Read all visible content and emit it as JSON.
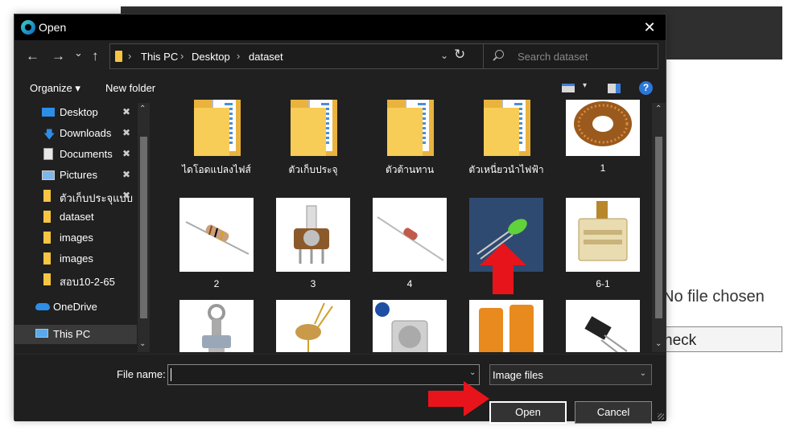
{
  "background": {
    "no_file_text": "No file chosen",
    "check_text": "neck"
  },
  "dialog": {
    "title": "Open",
    "close_glyph": "✕"
  },
  "nav": {
    "back_glyph": "←",
    "forward_glyph": "→",
    "recent_glyph": "⌄",
    "up_glyph": "↑",
    "breadcrumbs": [
      "This PC",
      "Desktop",
      "dataset"
    ],
    "breadcrumb_sep": "›",
    "dropdown_glyph": "⌄",
    "refresh_glyph": "↻",
    "search_placeholder": "Search dataset"
  },
  "toolbar": {
    "organize": "Organize ▾",
    "new_folder": "New folder",
    "view_drop": "▾",
    "help": "?"
  },
  "sidebar": {
    "items": [
      {
        "label": "Desktop",
        "icon": "desktop-icon",
        "pinned": true
      },
      {
        "label": "Downloads",
        "icon": "download-icon",
        "pinned": true
      },
      {
        "label": "Documents",
        "icon": "documents-icon",
        "pinned": true
      },
      {
        "label": "Pictures",
        "icon": "pictures-icon",
        "pinned": true
      },
      {
        "label": "ตัวเก็บประจุแบบ",
        "icon": "folder-icon",
        "pinned": true
      },
      {
        "label": "dataset",
        "icon": "folder-icon",
        "pinned": false
      },
      {
        "label": "images",
        "icon": "folder-icon",
        "pinned": false
      },
      {
        "label": "images",
        "icon": "folder-icon",
        "pinned": false
      },
      {
        "label": "สอบ10-2-65",
        "icon": "folder-icon",
        "pinned": false
      },
      {
        "label": "OneDrive",
        "icon": "cloud-icon",
        "pinned": false
      },
      {
        "label": "This PC",
        "icon": "computer-icon",
        "pinned": false
      }
    ],
    "pin_glyph": "📌",
    "scroll_up": "⌃",
    "scroll_down": "⌄"
  },
  "content": {
    "row1": [
      {
        "name": "ไดโอดแปลงไฟส์",
        "type": "folder"
      },
      {
        "name": "ตัวเก็บประจุ",
        "type": "folder"
      },
      {
        "name": "ตัวต้านทาน",
        "type": "folder"
      },
      {
        "name": "ตัวเหนี่ยวนำไฟฟ้า",
        "type": "folder"
      },
      {
        "name": "1",
        "type": "image"
      }
    ],
    "row2": [
      {
        "name": "2",
        "type": "image"
      },
      {
        "name": "3",
        "type": "image"
      },
      {
        "name": "4",
        "type": "image"
      },
      {
        "name": "",
        "type": "image"
      },
      {
        "name": "6-1",
        "type": "image"
      }
    ],
    "row3": [
      {
        "name": "",
        "type": "image"
      },
      {
        "name": "",
        "type": "image"
      },
      {
        "name": "",
        "type": "image"
      },
      {
        "name": "",
        "type": "image"
      },
      {
        "name": "",
        "type": "image"
      }
    ]
  },
  "bottom": {
    "file_name_label": "File name:",
    "file_name_value": "",
    "filter_value": "Image files",
    "open_label": "Open",
    "cancel_label": "Cancel"
  },
  "colors": {
    "accent_arrow": "#e8141b",
    "folder": "#f7c543",
    "dialog_bg": "#202020"
  }
}
